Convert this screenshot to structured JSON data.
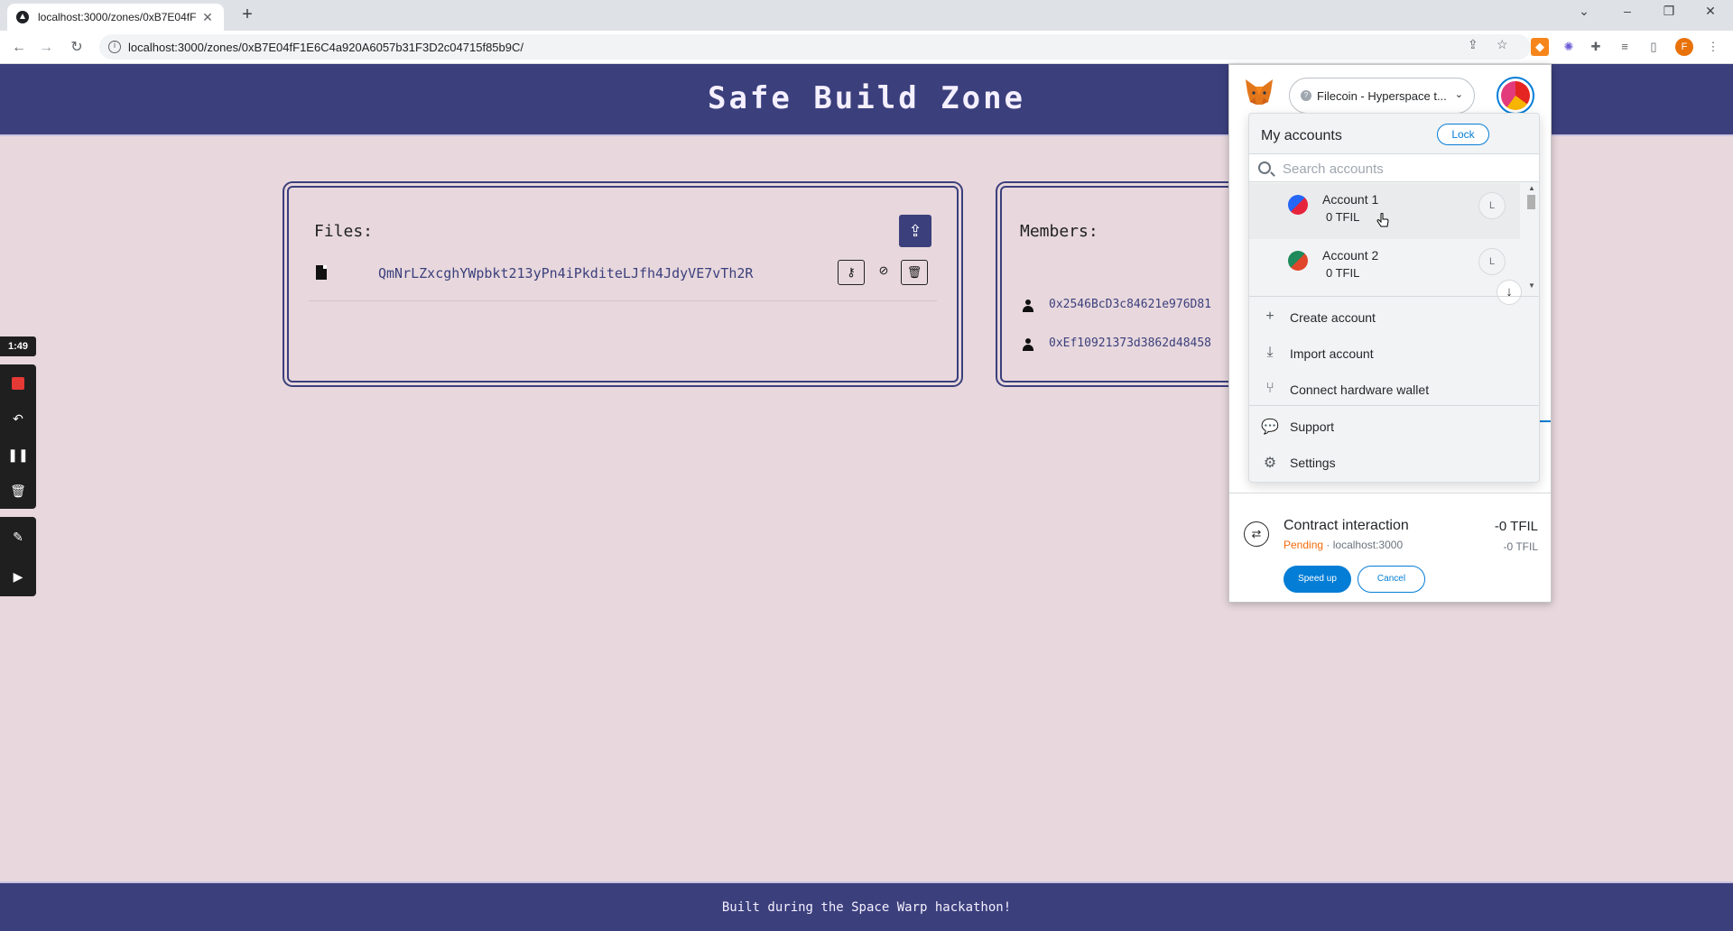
{
  "browser": {
    "tab_title": "localhost:3000/zones/0xB7E04fF",
    "tab_close": "✕",
    "new_tab": "+",
    "url": "localhost:3000/zones/0xB7E04fF1E6C4a920A6057b31F3D2c04715f85b9C/",
    "profile_initial": "F"
  },
  "site": {
    "title": "Safe Build Zone",
    "files_heading": "Files:",
    "files": [
      {
        "cid": "QmNrLZxcghYWpbkt213yPn4iPkditeLJfh4JdyVE7vTh2R"
      }
    ],
    "members_heading": "Members:",
    "members": [
      {
        "address": "0x2546BcD3c84621e976D81"
      },
      {
        "address": "0xEf10921373d3862d48458"
      }
    ],
    "footer": "Built during the Space Warp hackathon!"
  },
  "recorder": {
    "time": "1:49"
  },
  "metamask": {
    "network": "Filecoin - Hyperspace t...",
    "network_badge": "?",
    "my_accounts": "My accounts",
    "lock": "Lock",
    "search_placeholder": "Search accounts",
    "accounts": [
      {
        "name": "Account 1",
        "balance": "0 TFIL",
        "badge": "L",
        "color1": "#2566f6",
        "color2": "#e5243b"
      },
      {
        "name": "Account 2",
        "balance": "0 TFIL",
        "badge": "L",
        "color1": "#1f8a5b",
        "color2": "#e0462a"
      }
    ],
    "menu": {
      "create": "Create account",
      "import": "Import account",
      "hardware": "Connect hardware wallet",
      "support": "Support",
      "settings": "Settings"
    },
    "tx": {
      "title": "Contract interaction",
      "amount": "-0 TFIL",
      "status": "Pending",
      "origin": "localhost:3000",
      "sub_amount": "-0 TFIL",
      "speed_up": "Speed up",
      "cancel": "Cancel"
    }
  },
  "colors": {
    "brand": "#3b3f7c",
    "page_bg": "#e8d8dd",
    "metamask_blue": "#037dd6",
    "pending": "#f66a0a"
  }
}
